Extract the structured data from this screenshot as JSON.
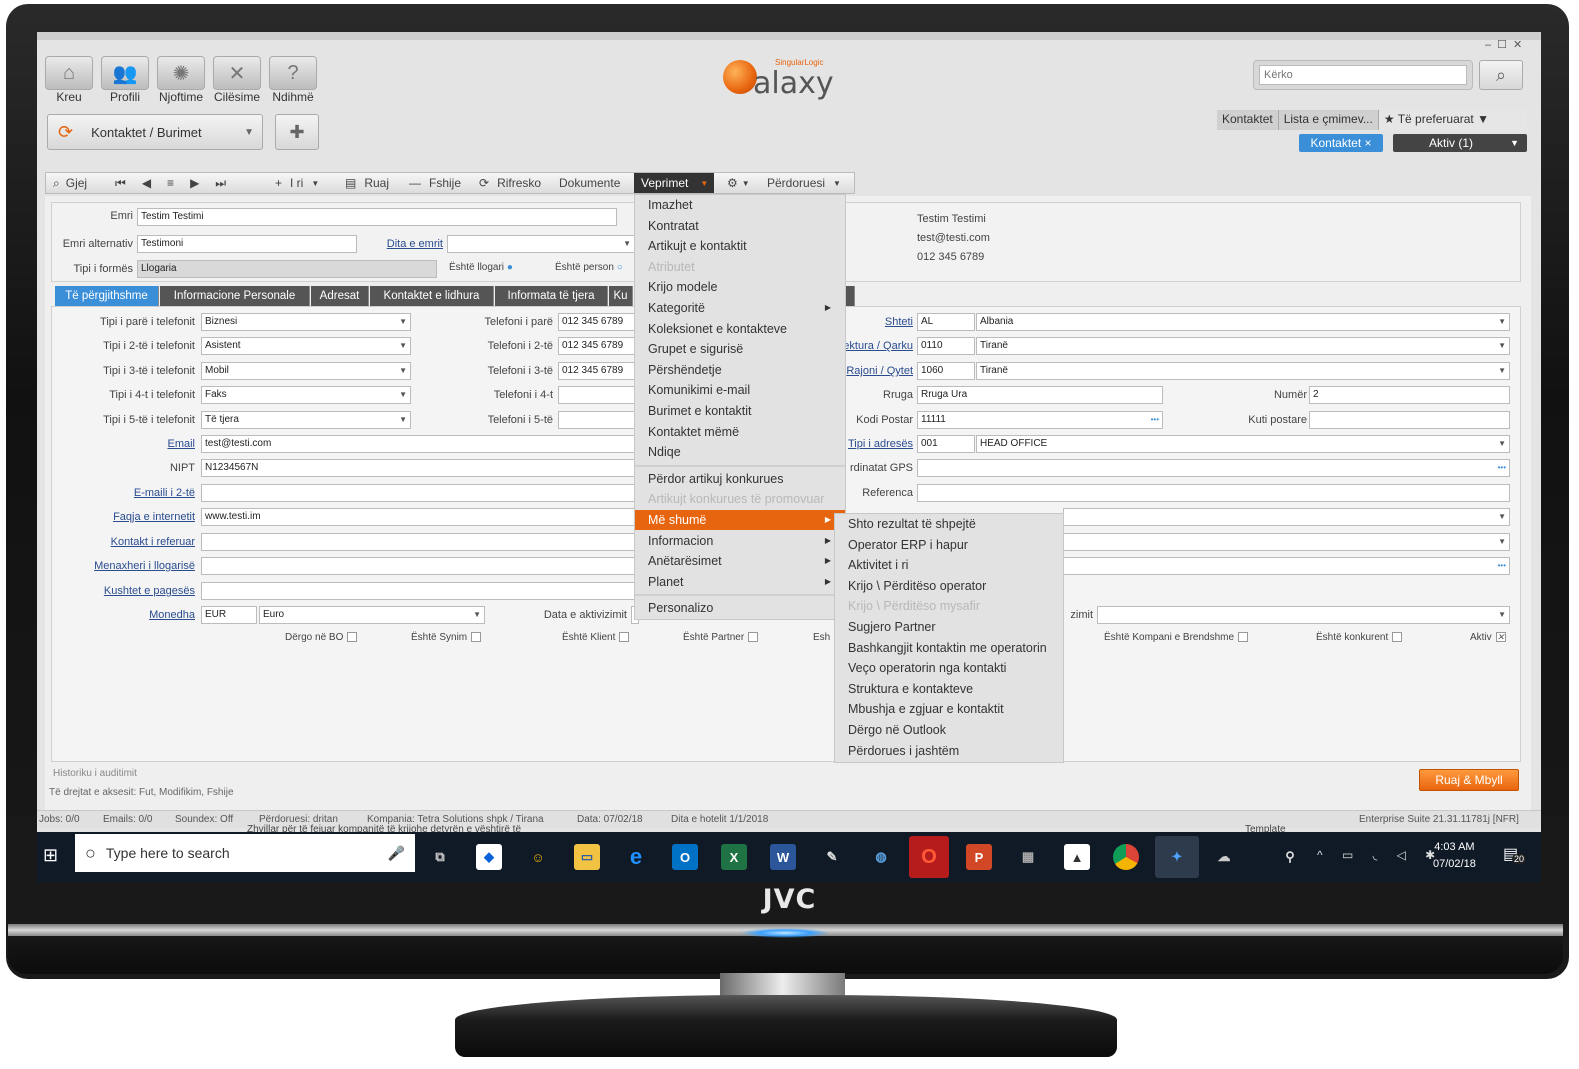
{
  "device": {
    "brand": "JVC"
  },
  "window": {
    "controls": [
      "–",
      "☐",
      "✕"
    ]
  },
  "logo": {
    "text": "alaxy",
    "sub": "SingularLogic"
  },
  "search": {
    "placeholder": "Kërko"
  },
  "nav": [
    {
      "label": "Kreu",
      "icon": "home-icon"
    },
    {
      "label": "Profili",
      "icon": "profile-icon"
    },
    {
      "label": "Njoftime",
      "icon": "notifications-icon"
    },
    {
      "label": "Cilësime",
      "icon": "settings-icon"
    },
    {
      "label": "Ndihmë",
      "icon": "help-icon"
    }
  ],
  "module": {
    "label": "Kontaktet / Burimet"
  },
  "quick_tabs": [
    "Kontaktet",
    "Lista e çmimev...",
    "★ Të preferuarat ▼"
  ],
  "active_tabs": {
    "current": "Kontaktet",
    "active": "Aktiv (1)"
  },
  "toolbar": {
    "find": "Gjej",
    "nav": [
      "⏮",
      "◀",
      "≡",
      "▶",
      "⏭"
    ],
    "new": "I ri",
    "save": "Ruaj",
    "delete": "Fshije",
    "refresh": "Rifresko",
    "documents": "Dokumente",
    "actions": "Veprimet",
    "user": "Përdoruesi"
  },
  "header": {
    "name_label": "Emri",
    "name_value": "Testim Testimi",
    "alt_label": "Emri alternativ",
    "alt_value": "Testimoni",
    "nameday_label": "Dita e emrit",
    "formtype_label": "Tipi i formës",
    "formtype_value": "Llogaria",
    "is_account": "Është llogari",
    "is_person": "Është person"
  },
  "summary": {
    "name": "Testim Testimi",
    "email": "test@testi.com",
    "phone": "012 345 6789"
  },
  "tabs": [
    "Të përgjithshme",
    "Informacione Personale",
    "Adresat",
    "Kontaktet e lidhura",
    "Informata të tjera",
    "Ku"
  ],
  "phones": [
    {
      "type_label": "Tipi i parë i telefonit",
      "type": "Biznesi",
      "tel_label": "Telefoni i parë",
      "tel": "012 345 6789"
    },
    {
      "type_label": "Tipi i 2-të i telefonit",
      "type": "Asistent",
      "tel_label": "Telefoni i 2-të",
      "tel": "012 345 6789"
    },
    {
      "type_label": "Tipi i 3-të i telefonit",
      "type": "Mobil",
      "tel_label": "Telefoni i 3-të",
      "tel": "012 345 6789"
    },
    {
      "type_label": "Tipi i 4-t i telefonit",
      "type": "Faks",
      "tel_label": "Telefoni i 4-t",
      "tel": ""
    },
    {
      "type_label": "Tipi i 5-të i telefonit",
      "type": "Të tjera",
      "tel_label": "Telefoni i 5-të",
      "tel": ""
    }
  ],
  "fields": [
    {
      "label": "Email",
      "value": "test@testi.com",
      "link": true
    },
    {
      "label": "NIPT",
      "value": "N1234567N",
      "link": false
    },
    {
      "label": "E-maili i 2-të",
      "value": "",
      "link": true
    },
    {
      "label": "Faqja e internetit",
      "value": "www.testi.im",
      "link": true
    },
    {
      "label": "Kontakt i referuar",
      "value": "",
      "link": true
    },
    {
      "label": "Menaxheri i llogarisë",
      "value": "",
      "link": true
    },
    {
      "label": "Kushtet e pagesës",
      "value": "",
      "link": true
    }
  ],
  "currency": {
    "label": "Monedha",
    "code": "EUR",
    "name": "Euro",
    "activation_label": "Data e aktivizimit"
  },
  "address": {
    "country_label": "Shteti",
    "country_code": "AL",
    "country": "Albania",
    "region_label": "ektura / Qarku",
    "region_code": "0110",
    "region": "Tiranë",
    "city_label": "Rajoni / Qytet",
    "city_code": "1060",
    "city": "Tiranë",
    "street_label": "Rruga",
    "street": "Rruga Ura",
    "number_label": "Numër",
    "number": "2",
    "postal_label": "Kodi Postar",
    "postal": "11111",
    "pobox_label": "Kuti postare",
    "addrtype_label": "Tipi i adresës",
    "addrtype_code": "001",
    "addrtype": "HEAD OFFICE",
    "gps_label": "rdinatat GPS",
    "ref_label": "Referenca",
    "zimit_label": "zimit"
  },
  "checks": [
    {
      "label": "Dërgo në BO",
      "checked": false
    },
    {
      "label": "Është Synim",
      "checked": false
    },
    {
      "label": "Është Klient",
      "checked": false
    },
    {
      "label": "Është Partner",
      "checked": false
    },
    {
      "label": "Esh",
      "checked": false
    },
    {
      "label": "Është Kompani e Brendshme",
      "checked": false
    },
    {
      "label": "Është konkurent",
      "checked": false
    },
    {
      "label": "Aktiv",
      "checked": true
    }
  ],
  "footer": {
    "audit": "Historiku i auditimit",
    "rights": "Të drejtat e aksesit: Fut, Modifikim, Fshije",
    "save_close": "Ruaj & Mbyll"
  },
  "statusbar": {
    "jobs": "Jobs: 0/0",
    "emails": "Emails: 0/0",
    "soundex": "Soundex: Off",
    "user": "Përdoruesi: dritan",
    "company": "Kompania: Tetra Solutions shpk / Tirana",
    "date": "Data: 07/02/18",
    "hotel_day": "Dita e hotelit 1/1/2018",
    "version": "Enterprise Suite 21.31.11781j [NFR]"
  },
  "actions_menu": [
    {
      "label": "Imazhet",
      "state": "normal"
    },
    {
      "label": "Kontratat",
      "state": "normal"
    },
    {
      "label": "Artikujt e kontaktit",
      "state": "normal"
    },
    {
      "label": "Atributet",
      "state": "disabled"
    },
    {
      "label": "Krijo modele",
      "state": "normal"
    },
    {
      "label": "Kategoritë",
      "state": "normal",
      "sub": true
    },
    {
      "label": "Koleksionet e kontakteve",
      "state": "normal"
    },
    {
      "label": "Grupet e sigurisë",
      "state": "normal"
    },
    {
      "label": "Përshëndetje",
      "state": "normal"
    },
    {
      "label": "Komunikimi e-mail",
      "state": "normal"
    },
    {
      "label": "Burimet e kontaktit",
      "state": "normal"
    },
    {
      "label": "Kontaktet mëmë",
      "state": "normal"
    },
    {
      "label": "Ndiqe",
      "state": "normal"
    },
    {
      "label": "Përdor artikuj konkurues",
      "state": "normal",
      "sep_before": true
    },
    {
      "label": "Artikujt konkurues të promovuar",
      "state": "disabled"
    },
    {
      "label": "Më shumë",
      "state": "highlight",
      "sub": true
    },
    {
      "label": "Informacion",
      "state": "normal",
      "sub": true
    },
    {
      "label": "Anëtarësimet",
      "state": "normal",
      "sub": true
    },
    {
      "label": "Planet",
      "state": "normal",
      "sub": true
    },
    {
      "label": "Personalizo",
      "state": "normal",
      "sep_before": true
    }
  ],
  "more_menu": [
    {
      "label": "Shto rezultat të shpejtë",
      "state": "normal"
    },
    {
      "label": "Operator ERP i hapur",
      "state": "normal"
    },
    {
      "label": "Aktivitet i ri",
      "state": "normal"
    },
    {
      "label": "Krijo \\ Përditëso operator",
      "state": "normal"
    },
    {
      "label": "Krijo \\ Përditëso mysafir",
      "state": "disabled"
    },
    {
      "label": "Sugjero Partner",
      "state": "normal"
    },
    {
      "label": "Bashkangjit kontaktin me operatorin",
      "state": "normal"
    },
    {
      "label": "Veço operatorin nga kontakti",
      "state": "normal"
    },
    {
      "label": "Struktura e kontakteve",
      "state": "normal"
    },
    {
      "label": "Mbushja e zgjuar e kontaktit",
      "state": "normal"
    },
    {
      "label": "Dërgo në Outlook",
      "state": "normal"
    },
    {
      "label": "Përdorues i jashtëm",
      "state": "normal"
    }
  ],
  "taskbar": {
    "search_placeholder": "Type here to search",
    "time": "4:03 AM",
    "date": "07/02/18",
    "notif_count": "20",
    "overlap_text": "Zhvillar për të fejuar kompanitë të krijohe detyrën e vështirë të",
    "overlap_right": "Template"
  }
}
